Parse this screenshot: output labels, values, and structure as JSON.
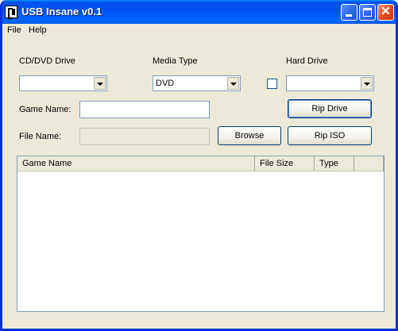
{
  "window": {
    "title": "USB Insane v0.1",
    "icon": "usb-insane-app-icon",
    "controls": {
      "minimize_icon": "minimize-icon",
      "maximize_icon": "maximize-icon",
      "close_icon": "close-icon",
      "close_glyph": "✕"
    }
  },
  "menu": [
    "File",
    "Help"
  ],
  "fields": {
    "cd_dvd_drive": {
      "label": "CD/DVD Drive",
      "value": ""
    },
    "media_type": {
      "label": "Media Type",
      "value": "DVD"
    },
    "hard_drive": {
      "label": "Hard Drive",
      "value": ""
    },
    "game_name": {
      "label": "Game Name:",
      "value": ""
    },
    "file_name": {
      "label": "File Name:",
      "value": ""
    }
  },
  "buttons": {
    "rip_drive": "Rip Drive",
    "browse": "Browse",
    "rip_iso": "Rip ISO"
  },
  "list": {
    "columns": [
      "Game Name",
      "File Size",
      "Type",
      ""
    ],
    "rows": []
  },
  "colors": {
    "titlebar": "#0054e3",
    "window_bg": "#ece9d8",
    "border": "#0831d9"
  }
}
